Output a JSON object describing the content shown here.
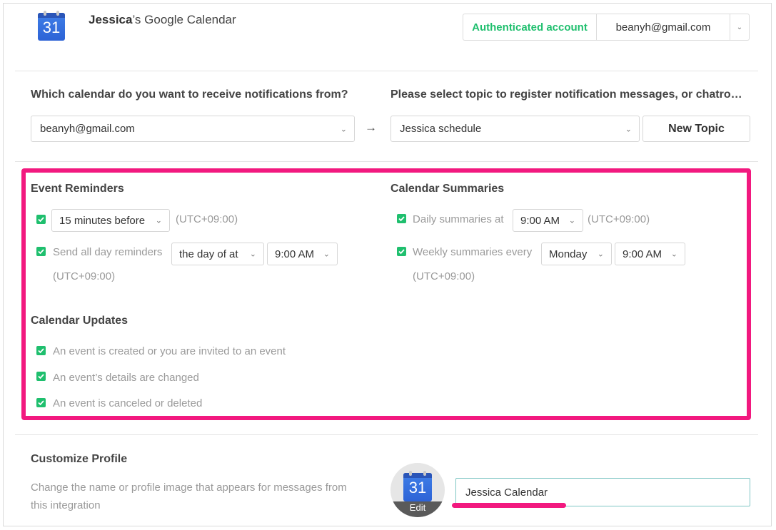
{
  "header": {
    "app_icon_number": "31",
    "title_owner": "Jessica",
    "title_rest": "’s Google Calendar",
    "auth_label": "Authenticated account",
    "account_email": "beanyh@gmail.com"
  },
  "source": {
    "question": "Which calendar do you want to receive notifications from?",
    "selected_calendar": "beanyh@gmail.com",
    "arrow": "→"
  },
  "destination": {
    "question": "Please select topic to register notification messages, or chatro…",
    "selected_topic": "Jessica schedule",
    "new_topic_label": "New Topic"
  },
  "event_reminders": {
    "heading": "Event Reminders",
    "reminder_time": "15 minutes before",
    "timezone_1": "(UTC+09:00)",
    "all_day_label": "Send all day reminders",
    "all_day_when": "the day of at",
    "all_day_time": "9:00 AM",
    "timezone_2": "(UTC+09:00)"
  },
  "calendar_summaries": {
    "heading": "Calendar Summaries",
    "daily_label": "Daily summaries at",
    "daily_time": "9:00 AM",
    "timezone_1": "(UTC+09:00)",
    "weekly_label": "Weekly summaries every",
    "weekly_day": "Monday",
    "weekly_time": "9:00 AM",
    "timezone_2": "(UTC+09:00)"
  },
  "calendar_updates": {
    "heading": "Calendar Updates",
    "items": [
      "An event is created or you are invited to an event",
      "An event’s details are changed",
      "An event is canceled or deleted"
    ]
  },
  "profile": {
    "heading": "Customize Profile",
    "description_line1": "Change the name or profile image that appears for messages from",
    "description_line2": "this integration",
    "avatar_number": "31",
    "edit_label": "Edit",
    "name_value": "Jessica Calendar"
  },
  "colors": {
    "accent_green": "#1fbf6e",
    "highlight_pink": "#f2197f",
    "calendar_blue": "#3f7fe8"
  }
}
